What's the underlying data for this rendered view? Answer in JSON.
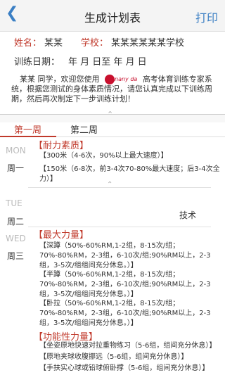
{
  "header": {
    "back_icon": "chevron-left-icon",
    "title": "生成计划表",
    "print_label": "打印"
  },
  "info": {
    "name_label": "姓名：",
    "name_value": "某某",
    "school_label": "学校：",
    "school_value": "某某某某某某学校",
    "date_label": "训练日期：",
    "date_text": "年 月 日至 年 月 日",
    "intro_name": "某某",
    "intro_a": "同学，欢迎您使用",
    "logo_text": "nany da",
    "intro_b": "高考体育训练专家系统，根据您测试的身体素质情况，请您认真完成以下训练周期，然后再次制定下一步训练计划！"
  },
  "tabs": [
    {
      "label": "第一周"
    },
    {
      "label": "第二周"
    }
  ],
  "days": {
    "mon_en": "MON",
    "mon_cn": "周一",
    "tue_en": "TUE",
    "tue_cn": "周二",
    "wed_en": "WED",
    "wed_cn": "周三"
  },
  "mon": {
    "section": "【耐力素质】",
    "item1": "【300米（4-6次，90%以上最大速度）】",
    "item2": "【150米（6-8次，前3-4次70-80%最大速度；后3-4次全力）】"
  },
  "tue": {
    "tech": "技术"
  },
  "wed": {
    "section1": "【最大力量】",
    "item1": "【深蹲（50%-60%RM,1-2组，8-15次/组；70%-80%RM，2-3组，6-10次/组;90%RM以上，2-3组，3-5次/组组间充分休息。）】",
    "item2": "【半蹲（50%-60%RM,1-2组，8-15次/组；70%-80%RM，2-3组，6-10次/组;90%RM以上，2-3组，3-5次/组组间充分休息。）】",
    "item3": "【卧拉（50%-60%RM,1-2组，8-15次/组；70%-80%RM，2-3组，6-10次/组;90%RM以上，2-3组，3-5次/组组间充分休息。）】",
    "section2": "【功能性力量】",
    "item4": "【坐姿原地快速对拉重物练习（5-6组，组间充分休息）】",
    "item5": "【原地夹球收腹挪远（5-6组，组间充分休息）】",
    "item6": "【手扶实心球或铅球俯卧撑（5-6组，组间充分休息）】"
  }
}
